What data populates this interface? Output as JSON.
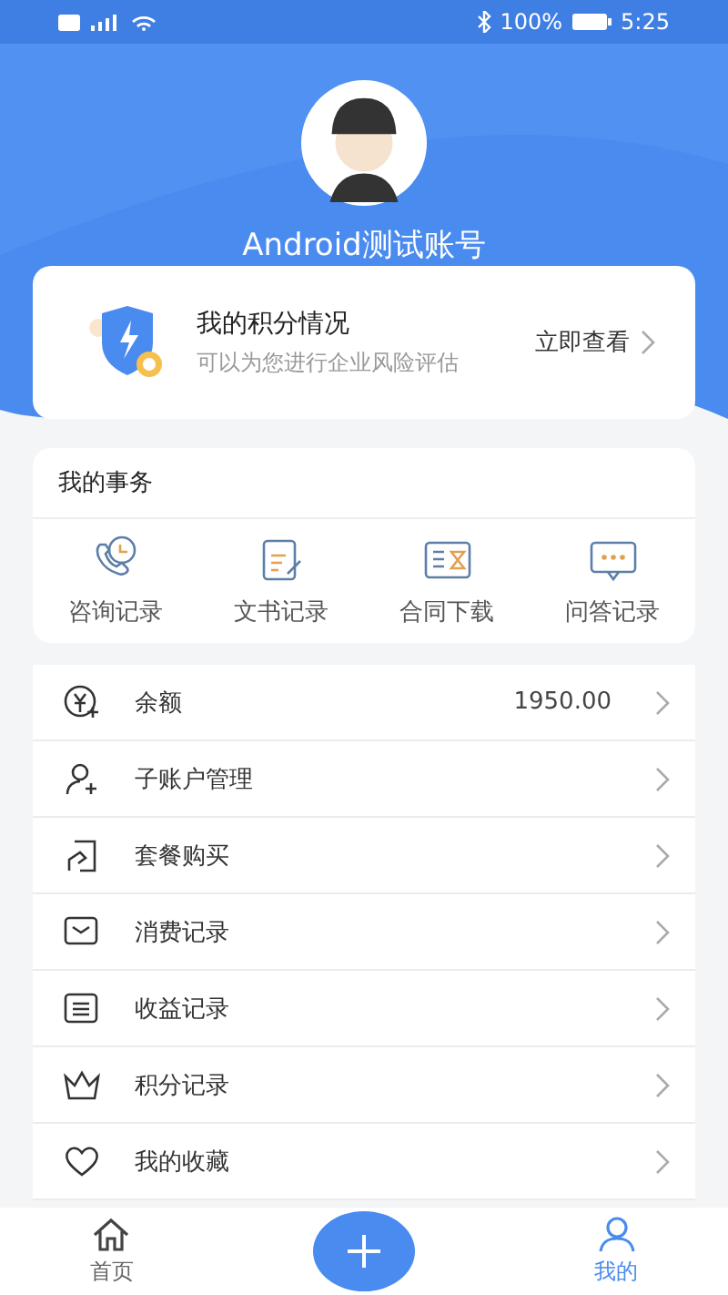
{
  "status_bar": {
    "battery": "100%",
    "time": "5:25"
  },
  "profile": {
    "name": "Android测试账号"
  },
  "points_card": {
    "title": "我的积分情况",
    "subtitle": "可以为您进行企业风险评估",
    "action": "立即查看"
  },
  "tasks": {
    "title": "我的事务",
    "items": [
      {
        "label": "咨询记录",
        "kind": "phone"
      },
      {
        "label": "文书记录",
        "kind": "document"
      },
      {
        "label": "合同下载",
        "kind": "hourglass"
      },
      {
        "label": "问答记录",
        "kind": "chat"
      }
    ]
  },
  "menu": [
    {
      "label": "余额",
      "value": "1950.00",
      "kind": "balance"
    },
    {
      "label": "子账户管理",
      "kind": "user"
    },
    {
      "label": "套餐购买",
      "kind": "package"
    },
    {
      "label": "消费记录",
      "kind": "envelope"
    },
    {
      "label": "收益记录",
      "kind": "list"
    },
    {
      "label": "积分记录",
      "kind": "crown"
    },
    {
      "label": "我的收藏",
      "kind": "heart"
    }
  ],
  "nav": [
    {
      "label": "首页",
      "kind": "home",
      "selected": false
    },
    {
      "kind": "add",
      "selected": false
    },
    {
      "label": "我的",
      "kind": "profile",
      "selected": true
    }
  ]
}
